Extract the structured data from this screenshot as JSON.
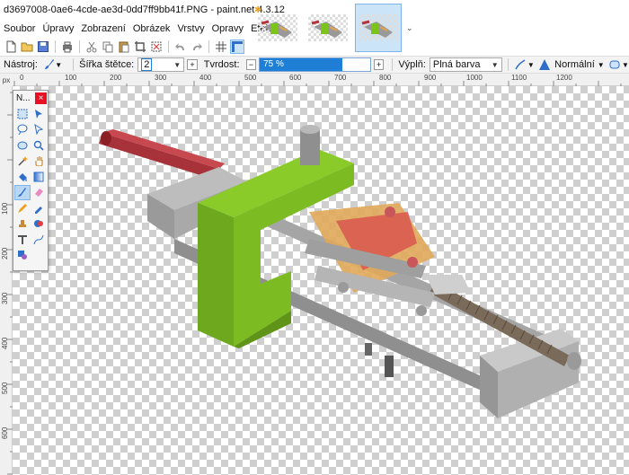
{
  "window": {
    "title": "d3697008-0ae6-4cde-ae3d-0dd7ff9bb41f.PNG - paint.net 4.3.12"
  },
  "menu": [
    {
      "label": "Soubor"
    },
    {
      "label": "Úpravy"
    },
    {
      "label": "Zobrazení"
    },
    {
      "label": "Obrázek"
    },
    {
      "label": "Vrstvy"
    },
    {
      "label": "Opravy"
    },
    {
      "label": "Efekty"
    }
  ],
  "image_tabs": {
    "count_visible": 3,
    "active_index": 2
  },
  "options": {
    "tool_label": "Nástroj:",
    "brush_width_label": "Šířka štětce:",
    "brush_width_value": "2",
    "hardness_label": "Tvrdost:",
    "hardness_value": "75 %",
    "hardness_fraction": 0.75,
    "fill_label": "Výplň:",
    "fill_value": "Plná barva",
    "blend_value": "Normální"
  },
  "ruler": {
    "unit": "px",
    "top_ticks": [
      "0",
      "100",
      "200",
      "300",
      "400",
      "500",
      "600",
      "700",
      "800",
      "900",
      "1000",
      "1100",
      "1200"
    ],
    "left_ticks": [
      "100",
      "200",
      "300",
      "400",
      "500",
      "600"
    ]
  },
  "tools_window": {
    "title": "N..."
  },
  "colors": {
    "accent": "#1f7fd7",
    "active_tab": "#cce4f7",
    "close": "#e81123"
  }
}
